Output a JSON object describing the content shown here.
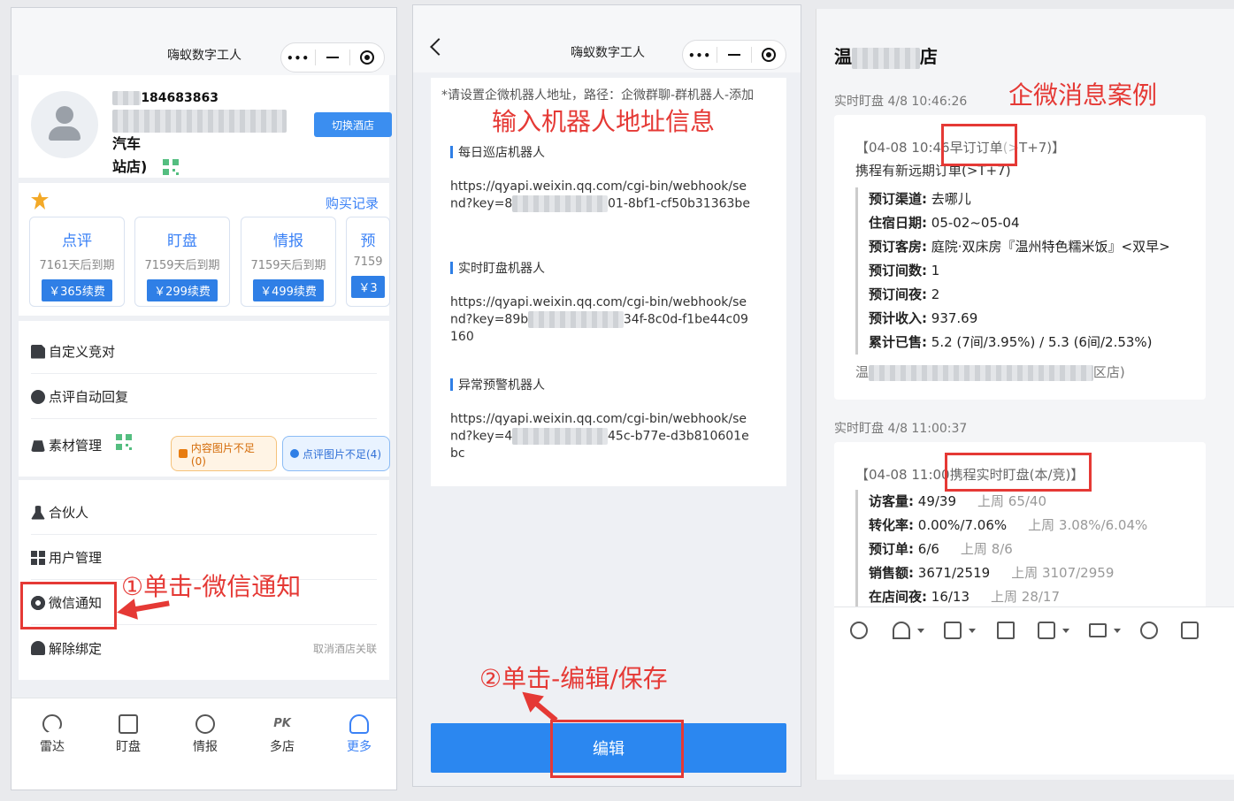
{
  "phone1": {
    "title": "嗨蚁数字工人",
    "store": {
      "id_visible": "184683863",
      "name_tail": "汽车",
      "name_line2": "站店)",
      "switch_label": "切换酒店"
    },
    "subscription": {
      "buy_record": "购买记录",
      "tiles": [
        {
          "name": "点评",
          "expire": "7161天后到期",
          "price": "￥365续费"
        },
        {
          "name": "盯盘",
          "expire": "7159天后到期",
          "price": "￥299续费"
        },
        {
          "name": "情报",
          "expire": "7159天后到期",
          "price": "￥499续费"
        },
        {
          "name": "预",
          "expire": "7159",
          "price": "￥3"
        }
      ]
    },
    "menu1": {
      "custom_competitor": "自定义竞对",
      "auto_reply": "点评自动回复",
      "material": "素材管理",
      "chip_content": "内容图片不足(0)",
      "chip_review": "点评图片不足(4)"
    },
    "menu2": {
      "partner": "合伙人",
      "user_manage": "用户管理",
      "wechat_notify": "微信通知",
      "unbind": "解除绑定",
      "unbind_hint": "取消酒店关联"
    },
    "tabbar": [
      {
        "label": "雷达"
      },
      {
        "label": "盯盘"
      },
      {
        "label": "情报"
      },
      {
        "label": "多店",
        "glyph": "PK"
      },
      {
        "label": "更多"
      }
    ]
  },
  "phone2": {
    "title": "嗨蚁数字工人",
    "hint": "*请设置企微机器人地址，路径：企微群聊-群机器人-添加",
    "bots": [
      {
        "label": "每日巡店机器人",
        "url_start": "https://qyapi.weixin.qq.com/cgi-bin/webhook/send?key=8",
        "url_mid": "01-",
        "url_end": "8bf1-cf50b31363be"
      },
      {
        "label": "实时盯盘机器人",
        "url_start": "https://qyapi.weixin.qq.com/cgi-bin/webhook/send?key=89b",
        "url_mid": "34f-",
        "url_end": "8c0d-f1be44c09160"
      },
      {
        "label": "异常预警机器人",
        "url_start": "https://qyapi.weixin.qq.com/cgi-bin/webhook/send?key=4",
        "url_mid": "45c-",
        "url_end": "b77e-d3b810601ebc"
      }
    ],
    "edit_label": "编辑"
  },
  "chat": {
    "title_start": "温",
    "title_end": "店",
    "msg1": {
      "meta": "实时盯盘  4/8 10:46:26",
      "head": "【04-08 10:46",
      "head_box": "早订订单",
      "head_tail": "T+7)】",
      "sub": "携程有新远期订单(>T+7)",
      "fields": [
        {
          "k": "预订渠道:",
          "v": "去哪儿"
        },
        {
          "k": "住宿日期:",
          "v": "05-02~05-04"
        },
        {
          "k": "预订客房:",
          "v": "庭院·双床房『温州特色糯米饭』<双早>"
        },
        {
          "k": "预订间数:",
          "v": "1"
        },
        {
          "k": "预订间夜:",
          "v": "2"
        },
        {
          "k": "预计收入:",
          "v": "937.69"
        },
        {
          "k": "累计已售:",
          "v": "5.2 (7间/3.95%) / 5.3 (6间/2.53%)"
        }
      ],
      "footer_start": "温",
      "footer_end": "区店)"
    },
    "msg2": {
      "meta": "实时盯盘  4/8 11:00:37",
      "head": "【04-08 11:00",
      "head_box": "携程实时盯盘(本/竞)",
      "head_tail": "】",
      "fields": [
        {
          "k": "访客量:",
          "v": "49/39",
          "last": "上周 65/40"
        },
        {
          "k": "转化率:",
          "v": "0.00%/7.06%",
          "last": "上周 3.08%/6.04%"
        },
        {
          "k": "预订单:",
          "v": "6/6",
          "last": "上周 8/6"
        },
        {
          "k": "销售额:",
          "v": "3671/2519",
          "last": "上周 3107/2959"
        },
        {
          "k": "在店间夜:",
          "v": "16/13",
          "last": "上周 28/17"
        }
      ]
    }
  },
  "annotations": {
    "step1": "①单击-微信通知",
    "step2": "②单击-编辑/保存",
    "input_hint": "输入机器人地址信息",
    "case_title": "企微消息案例"
  },
  "colors": {
    "accent_blue": "#3b82f6",
    "annotation_red": "#e53935",
    "primary_button": "#2b87f0"
  }
}
